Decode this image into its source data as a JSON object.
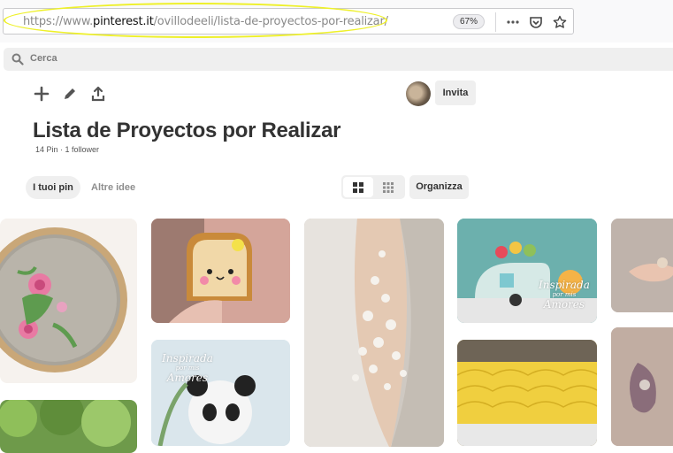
{
  "browser": {
    "url_prefix": "https://www.",
    "url_host": "pinterest.it",
    "url_path": "/ovillodeeli/lista-de-proyectos-por-realizar/",
    "zoom": "67%",
    "icons": [
      "more-icon",
      "pocket-icon",
      "bookmark-star-icon"
    ]
  },
  "search": {
    "placeholder": "Cerca"
  },
  "board": {
    "title": "Lista de Proyectos por Realizar",
    "meta": "14 Pin · 1 follower",
    "invite_label": "Invita"
  },
  "tabs": {
    "active": "I tuoi pin",
    "other": "Altre idee",
    "organize": "Organizza"
  },
  "pins": [
    {
      "subject": "cross-stitch embroidery hoop with roses"
    },
    {
      "subject": "crochet toast amigurumi"
    },
    {
      "subject": "beaded lace back of dress"
    },
    {
      "subject": "crochet caravan pincushion",
      "watermark_top": "Inspirada",
      "watermark_small": "por mis",
      "watermark_bottom": "Amores"
    },
    {
      "subject": "hand holding small crochet"
    },
    {
      "subject": "green foliage"
    },
    {
      "subject": "crochet panda",
      "watermark_top": "Inspirada",
      "watermark_small": "por mis",
      "watermark_bottom": "Amores"
    },
    {
      "subject": "yellow crochet bag"
    },
    {
      "subject": "beaded brooch"
    }
  ],
  "colors": {
    "highlight": "#eef02a",
    "chip": "#efefef"
  }
}
